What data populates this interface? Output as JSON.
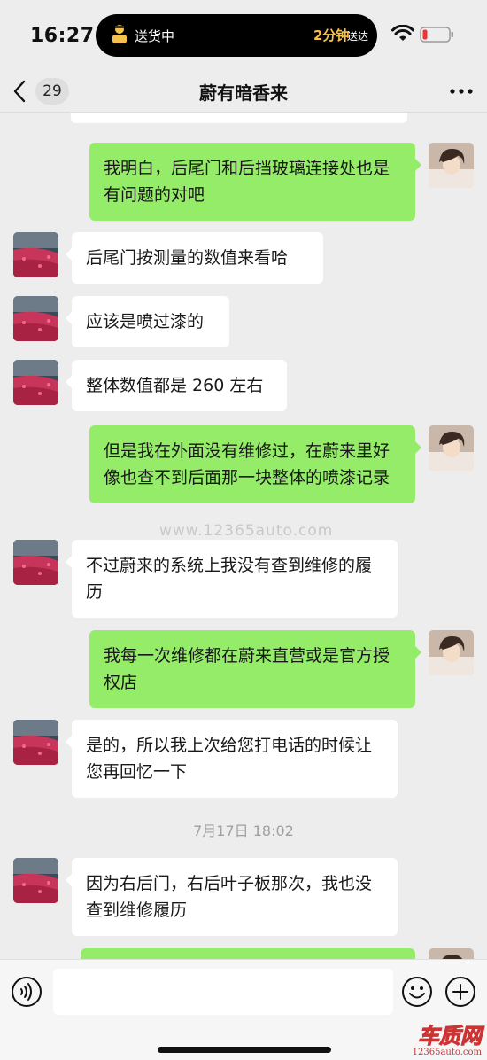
{
  "status_bar": {
    "time": "16:27",
    "activity_title": "送货中",
    "activity_value": "2分钟",
    "activity_suffix": "送达"
  },
  "nav": {
    "unread_count": "29",
    "title": "蔚有暗香来"
  },
  "messages": [
    {
      "side": "send",
      "text": "我明白，后尾门和后挡玻璃连接处也是有问题的对吧"
    },
    {
      "side": "recv",
      "text": "后尾门按测量的数值来看哈"
    },
    {
      "side": "recv",
      "text": "应该是喷过漆的"
    },
    {
      "side": "recv",
      "text": "整体数值都是 260 左右"
    },
    {
      "side": "send",
      "text": "但是我在外面没有维修过，在蔚来里好像也查不到后面那一块整体的喷漆记录"
    },
    {
      "side": "recv",
      "text": "不过蔚来的系统上我没有查到维修的履历"
    },
    {
      "side": "send",
      "text": "我每一次维修都在蔚来直营或是官方授权店"
    },
    {
      "side": "recv",
      "text": "是的，所以我上次给您打电话的时候让您再回忆一下"
    },
    {
      "side": "recv",
      "text": "因为右后门，右后叶子板那次，我也没查到维修履历"
    }
  ],
  "time_separator": "7月17日 18:02",
  "watermark": "www.12365auto.com",
  "corner_logo": {
    "name": "车质网",
    "url": "12365auto.com"
  },
  "colors": {
    "sent_bubble": "#95ec69",
    "received_bubble": "#ffffff",
    "background": "#ededed"
  }
}
